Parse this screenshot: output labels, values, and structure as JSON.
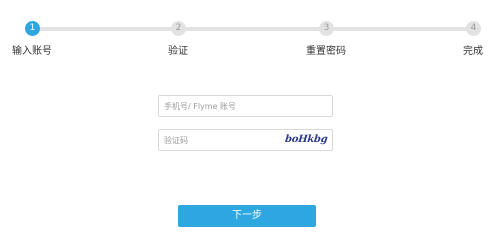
{
  "stepper": {
    "current_step": 1,
    "steps": [
      {
        "number": "1",
        "label": "输入账号"
      },
      {
        "number": "2",
        "label": "验证"
      },
      {
        "number": "3",
        "label": "重置密码"
      },
      {
        "number": "4",
        "label": "完成"
      }
    ]
  },
  "form": {
    "account_placeholder": "手机号/ Flyme 账号",
    "account_value": "",
    "captcha_placeholder": "验证码",
    "captcha_value": "",
    "captcha_text": "boHkbg"
  },
  "actions": {
    "next_label": "下一步"
  },
  "colors": {
    "accent": "#2ea7e0",
    "inactive": "#e2e2e2",
    "captcha_ink": "#2d3a8c"
  }
}
